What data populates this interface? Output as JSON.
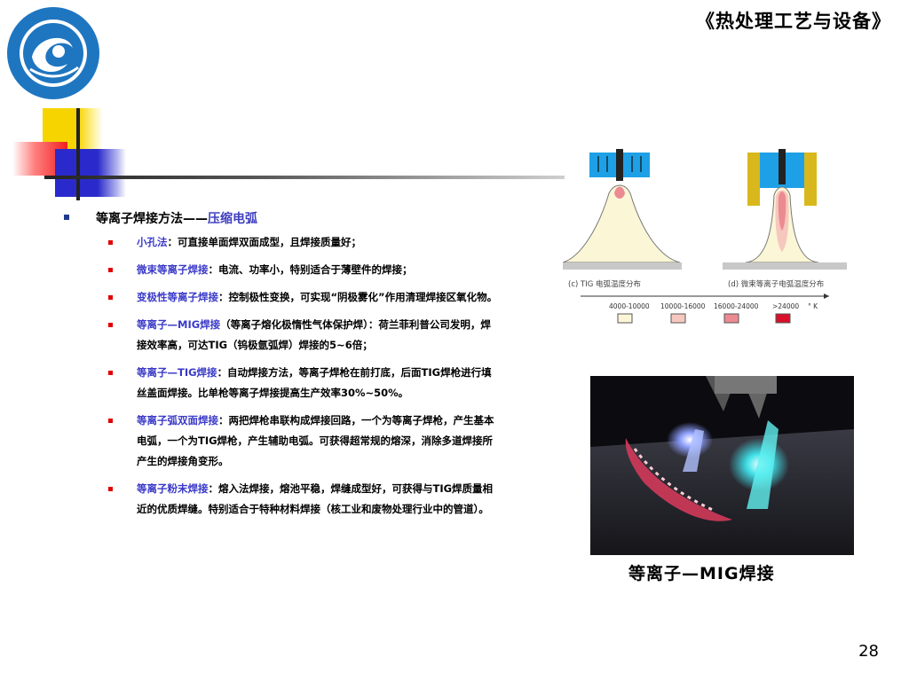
{
  "header": {
    "course_title": "《热处理工艺与设备》"
  },
  "logo": {
    "name": "school-logo"
  },
  "section": {
    "heading_prefix": "等离子焊接方法——",
    "heading_highlight": "压缩电弧"
  },
  "items": [
    {
      "term": "小孔法",
      "text": "：可直接单面焊双面成型，且焊接质量好；"
    },
    {
      "term": "微束等离子焊接",
      "text": "：电流、功率小，特别适合于薄壁件的焊接；"
    },
    {
      "term": "变极性等离子焊接",
      "text": "：控制极性变换，可实现“阴极雾化”作用清理焊接区氧化物。"
    },
    {
      "term": "等离子—MIG焊接",
      "text": "（等离子熔化极惰性气体保护焊）：荷兰菲利普公司发明，焊接效率高，可达TIG（钨极氩弧焊）焊接的5~6倍；"
    },
    {
      "term": "等离子—TIG焊接",
      "text": "：自动焊接方法，等离子焊枪在前打底，后面TIG焊枪进行填丝盖面焊接。比单枪等离子焊接提高生产效率30%~50%。"
    },
    {
      "term": "等离子弧双面焊接",
      "text": "：两把焊枪串联构成焊接回路，一个为等离子焊枪，产生基本电弧，一个为TIG焊枪，产生辅助电弧。可获得超常规的熔深，消除多道焊接所产生的焊接角变形。"
    },
    {
      "term": "等离子粉末焊接",
      "text": "：熔入法焊接，熔池平稳，焊缝成型好，可获得与TIG焊质量相近的优质焊缝。特别适合于特种材料焊接（核工业和废物处理行业中的管道）。"
    }
  ],
  "figure": {
    "label_c": "(c) TIG 电弧温度分布",
    "label_d": "(d) 微束等离子电弧温度分布",
    "legend": [
      {
        "range": "4000-10000",
        "color": "#fbf6d6"
      },
      {
        "range": "10000-16000",
        "color": "#f6c7bd"
      },
      {
        "range": "16000-24000",
        "color": "#ec8a92"
      },
      {
        "range": ">24000",
        "color": "#d8102a"
      }
    ],
    "unit": "° K"
  },
  "photo": {
    "caption": "等离子—MIG焊接"
  },
  "footer": {
    "page_number": "28"
  }
}
